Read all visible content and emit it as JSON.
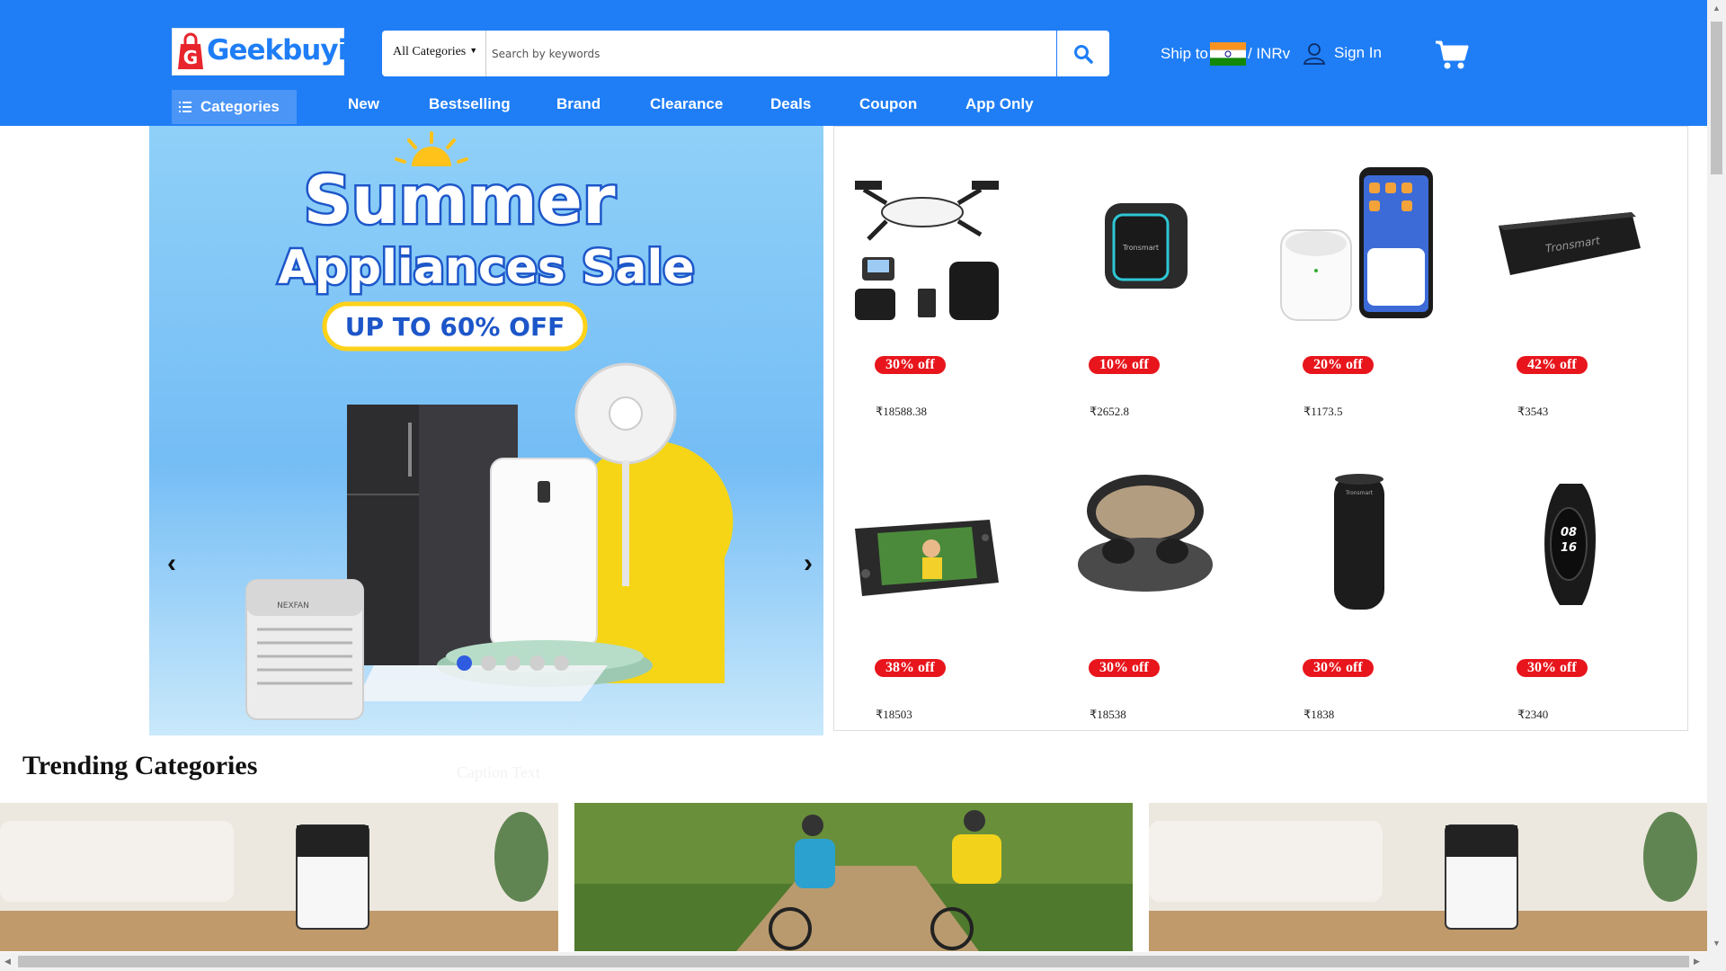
{
  "header": {
    "logo_text": "Geekbuying",
    "search": {
      "category": "All Categories",
      "placeholder": "Search by keywords"
    },
    "ship_to_label": "Ship to",
    "currency": "/ INRv",
    "sign_in": "Sign In",
    "icons": [
      "search-icon",
      "india-flag-icon",
      "user-icon",
      "cart-icon"
    ]
  },
  "nav": {
    "categories": "Categories",
    "items": [
      "New",
      "Bestselling",
      "Brand",
      "Clearance",
      "Deals",
      "Coupon",
      "App Only"
    ]
  },
  "banner": {
    "headline_1": "Summer",
    "headline_2": "Appliances Sale",
    "offer": "UP TO 60% OFF",
    "brand_mark": "NEXFAN",
    "prev": "‹",
    "next": "›",
    "slides": 5,
    "active_slide": 1
  },
  "deals": [
    {
      "discount": "30% off",
      "price": "₹18588.38",
      "product_icon": "drone-icon"
    },
    {
      "discount": "10% off",
      "price": "₹2652.8",
      "product_icon": "speaker-icon"
    },
    {
      "discount": "20% off",
      "price": "₹1173.5",
      "product_icon": "earbuds-phone-icon"
    },
    {
      "discount": "42% off",
      "price": "₹3543",
      "product_icon": "soundbar-icon"
    },
    {
      "discount": "38% off",
      "price": "₹18503",
      "product_icon": "handheld-console-icon"
    },
    {
      "discount": "30% off",
      "price": "₹18538",
      "product_icon": "earbuds-case-icon"
    },
    {
      "discount": "30% off",
      "price": "₹1838",
      "product_icon": "tower-speaker-icon"
    },
    {
      "discount": "30% off",
      "price": "₹2340",
      "product_icon": "fitness-band-icon"
    }
  ],
  "speaker_brand": "Tronsmart",
  "band_time_hours": "08",
  "band_time_minutes": "16",
  "trending": {
    "title": "Trending Categories",
    "caption": "Caption Text"
  },
  "colors": {
    "header_blue": "#1f7ef5",
    "badge_red": "#e8161c",
    "active_dot": "#2f5be0"
  }
}
